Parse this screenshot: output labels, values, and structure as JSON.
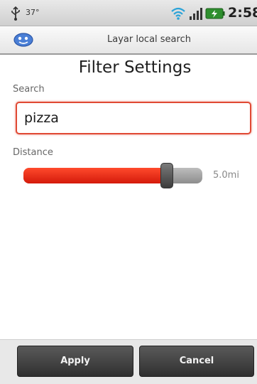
{
  "status_bar": {
    "temperature": "37°",
    "time": "2:58"
  },
  "title_bar": {
    "app_title": "Layar local search"
  },
  "page": {
    "title": "Filter Settings"
  },
  "search": {
    "label": "Search",
    "value": "pizza"
  },
  "distance": {
    "label": "Distance",
    "value_text": "5.0mi",
    "slider_fraction": 0.8
  },
  "buttons": {
    "apply": "Apply",
    "cancel": "Cancel"
  },
  "icons": {
    "status_left": "usb-icon",
    "status_wifi": "wifi-icon",
    "status_signal": "signal-icon",
    "status_battery": "battery-icon",
    "app_logo": "layar-logo-icon"
  },
  "colors": {
    "slider_fill": "#e1261a",
    "field_border": "#e04a35",
    "button_bg": "#3f3f3f"
  }
}
